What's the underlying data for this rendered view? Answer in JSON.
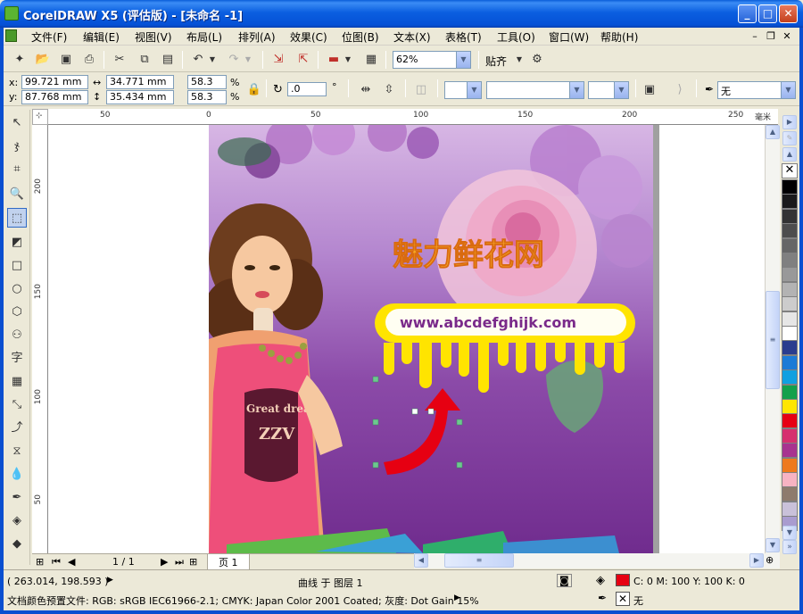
{
  "window": {
    "title": "CorelDRAW X5 (评估版) - [未命名 -1]",
    "minimize": "_",
    "maximize": "□",
    "close": "✕"
  },
  "menu": {
    "items": [
      "文件(F)",
      "编辑(E)",
      "视图(V)",
      "布局(L)",
      "排列(A)",
      "效果(C)",
      "位图(B)",
      "文本(X)",
      "表格(T)",
      "工具(O)",
      "窗口(W)",
      "帮助(H)"
    ],
    "doc_minimize": "–",
    "doc_restore": "❐",
    "doc_close": "✕"
  },
  "toolbar": {
    "zoom": "62%",
    "snap": "贴齐"
  },
  "properties": {
    "x_label": "x:",
    "y_label": "y:",
    "x_value": "99.721 mm",
    "y_value": "87.768 mm",
    "width_value": "34.771 mm",
    "height_value": "35.434 mm",
    "scale_x": "58.3",
    "scale_y": "58.3",
    "percent": "%",
    "rotation": ".0",
    "degree": "°",
    "outline": "无"
  },
  "rulers": {
    "horizontal_ticks": [
      "50",
      "0",
      "50",
      "100",
      "150",
      "200",
      "250"
    ],
    "vertical_ticks": [
      "200",
      "150",
      "100",
      "50"
    ],
    "units": "毫米"
  },
  "artwork": {
    "heading": "魅力鲜花网",
    "url": "www.abcdefghijk.com",
    "shirt_text": "Great dream",
    "shirt_logo": "ZZV"
  },
  "palette": {
    "colors": [
      "#000000",
      "#1a1a1a",
      "#333333",
      "#4d4d4d",
      "#666666",
      "#808080",
      "#999999",
      "#b3b3b3",
      "#cccccc",
      "#e6e6e6",
      "#ffffff",
      "#2a3c8e",
      "#1c7bd6",
      "#10a0e0",
      "#13a04a",
      "#ffe600",
      "#e60012",
      "#d6306e",
      "#a8338f",
      "#ee7a1c",
      "#f7b3c2",
      "#8e7b6c",
      "#c9c1d9",
      "#a99ccf"
    ]
  },
  "pages": {
    "counter": "1 / 1",
    "tab": "页 1"
  },
  "status": {
    "coords": "( 263.014, 198.593 )",
    "object_info": "曲线 于 图层 1",
    "fill_info": "C: 0 M: 100 Y: 100 K: 0",
    "fill_color": "#e60012",
    "color_profile": "文档颜色预置文件: RGB: sRGB IEC61966-2.1; CMYK: Japan Color 2001 Coated; 灰度: Dot Gain 15%",
    "outline_info": "无"
  }
}
